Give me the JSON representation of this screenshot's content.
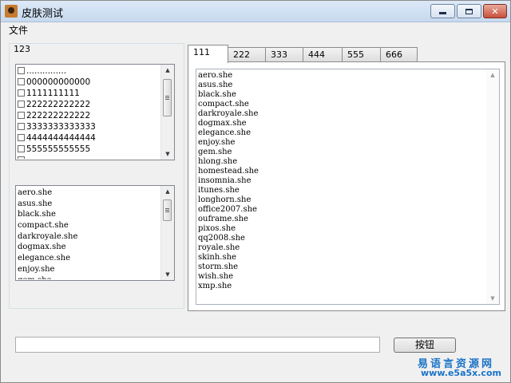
{
  "window": {
    "title": "皮肤测试"
  },
  "menu": {
    "items": [
      "文件"
    ]
  },
  "group": {
    "label": "123"
  },
  "checklist": {
    "items": [
      "...............",
      "000000000000",
      "1111111111",
      "222222222222",
      "222222222222",
      "3333333333333",
      "4444444444444",
      "555555555555",
      "_______________"
    ]
  },
  "skin_list": {
    "items": [
      "aero.she",
      "asus.she",
      "black.she",
      "compact.she",
      "darkroyale.she",
      "dogmax.she",
      "elegance.she",
      "enjoy.she",
      "gem.she"
    ]
  },
  "tabs": {
    "labels": [
      "111",
      "222",
      "333",
      "444",
      "555",
      "666"
    ],
    "active_index": 0
  },
  "tab_content": {
    "lines": [
      "aero.she",
      "asus.she",
      "black.she",
      "compact.she",
      "darkroyale.she",
      "dogmax.she",
      "elegance.she",
      "enjoy.she",
      "gem.she",
      "hlong.she",
      "homestead.she",
      "insomnia.she",
      "itunes.she",
      "longhorn.she",
      "office2007.she",
      "ouframe.she",
      "pixos.she",
      "qq2008.she",
      "royale.she",
      "skinh.she",
      "storm.she",
      "wish.she",
      "xmp.she"
    ]
  },
  "input": {
    "value": ""
  },
  "button": {
    "label": "按钮"
  },
  "watermark": {
    "line1": "易语言资源网",
    "line2": "www.e5a5x.com"
  }
}
